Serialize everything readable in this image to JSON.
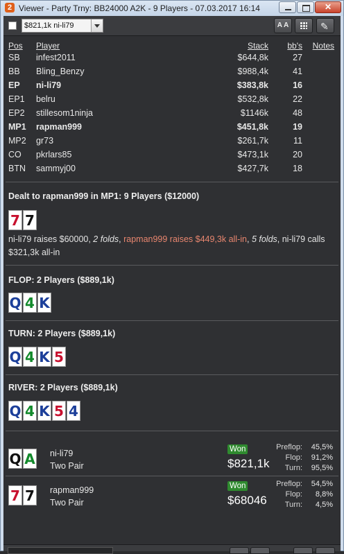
{
  "window": {
    "title": "Viewer - Party Trny: BB24000 A2K - 9 Players - 07.03.2017 16:14",
    "app_icon_letter": "2",
    "close_glyph": "✕"
  },
  "toolbar": {
    "hand_select_value": "$821,1k ni-li79",
    "font_button_label": "A A",
    "grid_icon": "grid-icon",
    "edit_icon": "pencil-icon",
    "pencil_glyph": "✎"
  },
  "table": {
    "headers": {
      "pos": "Pos",
      "player": "Player",
      "stack": "Stack",
      "bbs": "bb's",
      "notes": "Notes"
    },
    "rows": [
      {
        "pos": "SB",
        "player": "infest2011",
        "stack": "$644,8k",
        "bbs": "27",
        "bold": false
      },
      {
        "pos": "BB",
        "player": "Bling_Benzy",
        "stack": "$988,4k",
        "bbs": "41",
        "bold": false
      },
      {
        "pos": "EP",
        "player": "ni-li79",
        "stack": "$383,8k",
        "bbs": "16",
        "bold": true
      },
      {
        "pos": "EP1",
        "player": "belru",
        "stack": "$532,8k",
        "bbs": "22",
        "bold": false
      },
      {
        "pos": "EP2",
        "player": "stillesom1ninja",
        "stack": "$1146k",
        "bbs": "48",
        "bold": false
      },
      {
        "pos": "MP1",
        "player": "rapman999",
        "stack": "$451,8k",
        "bbs": "19",
        "bold": true
      },
      {
        "pos": "MP2",
        "player": "gr73",
        "stack": "$261,7k",
        "bbs": "11",
        "bold": false
      },
      {
        "pos": "CO",
        "player": "pkrlars85",
        "stack": "$473,1k",
        "bbs": "20",
        "bold": false
      },
      {
        "pos": "BTN",
        "player": "sammyj00",
        "stack": "$427,7k",
        "bbs": "18",
        "bold": false
      }
    ]
  },
  "preflop": {
    "title": "Dealt to rapman999 in MP1: 9 Players ($12000)",
    "cards": [
      {
        "rank": "7",
        "color": "#c8102e"
      },
      {
        "rank": "7",
        "color": "#111111"
      }
    ],
    "action_1": "ni-li79 raises $60000, ",
    "action_2": "2 folds",
    "action_3": ", ",
    "action_4": "rapman999 raises $449,3k all-in",
    "action_5": ", ",
    "action_6": "5 folds",
    "action_7": ", ni-li79 calls $321,3k all-in"
  },
  "flop": {
    "title": "FLOP: 2 Players ($889,1k)",
    "cards": [
      {
        "rank": "Q",
        "color": "#1c3f9a"
      },
      {
        "rank": "4",
        "color": "#138a2c"
      },
      {
        "rank": "K",
        "color": "#1c3f9a"
      }
    ]
  },
  "turn": {
    "title": "TURN: 2 Players ($889,1k)",
    "cards": [
      {
        "rank": "Q",
        "color": "#1c3f9a"
      },
      {
        "rank": "4",
        "color": "#138a2c"
      },
      {
        "rank": "K",
        "color": "#1c3f9a"
      },
      {
        "rank": "5",
        "color": "#c8102e"
      }
    ]
  },
  "river": {
    "title": "RIVER: 2 Players ($889,1k)",
    "cards": [
      {
        "rank": "Q",
        "color": "#1c3f9a"
      },
      {
        "rank": "4",
        "color": "#138a2c"
      },
      {
        "rank": "K",
        "color": "#1c3f9a"
      },
      {
        "rank": "5",
        "color": "#c8102e"
      },
      {
        "rank": "4",
        "color": "#1c3f9a"
      }
    ]
  },
  "results": [
    {
      "player": "ni-li79",
      "hand": "Two Pair",
      "cards": [
        {
          "rank": "Q",
          "color": "#111111"
        },
        {
          "rank": "A",
          "color": "#138a2c"
        }
      ],
      "won_label": "Won",
      "won_amount": "$821,1k",
      "equity": [
        {
          "label": "Preflop:",
          "value": "45,5%"
        },
        {
          "label": "Flop:",
          "value": "91,2%"
        },
        {
          "label": "Turn:",
          "value": "95,5%"
        }
      ]
    },
    {
      "player": "rapman999",
      "hand": "Two Pair",
      "cards": [
        {
          "rank": "7",
          "color": "#c8102e"
        },
        {
          "rank": "7",
          "color": "#111111"
        }
      ],
      "won_label": "Won",
      "won_amount": "$68046",
      "equity": [
        {
          "label": "Preflop:",
          "value": "54,5%"
        },
        {
          "label": "Flop:",
          "value": "8,8%"
        },
        {
          "label": "Turn:",
          "value": "4,5%"
        }
      ]
    }
  ],
  "colors": {
    "window_bg": "#2f3033",
    "raise_highlight": "#e8866f",
    "won_badge": "#2f8a2f",
    "card_red": "#c8102e",
    "card_blue": "#1c3f9a",
    "card_green": "#138a2c",
    "card_black": "#111111"
  }
}
